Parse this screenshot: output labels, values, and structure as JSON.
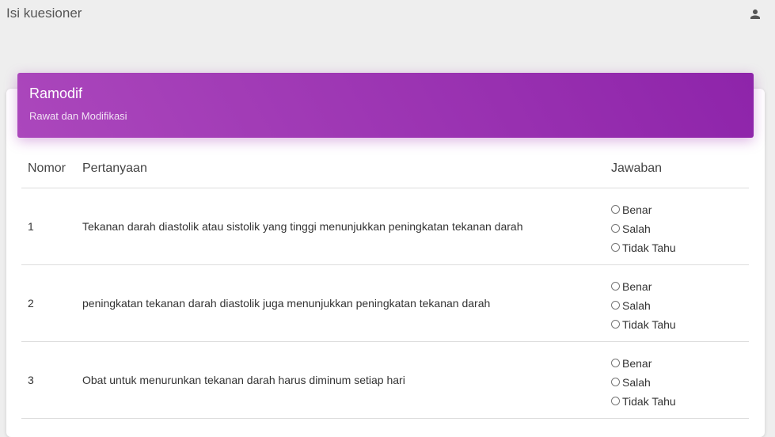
{
  "header": {
    "title": "Isi kuesioner",
    "user_icon": "person-icon"
  },
  "card": {
    "title": "Ramodif",
    "subtitle": "Rawat dan Modifikasi"
  },
  "table": {
    "columns": [
      "Nomor",
      "Pertanyaan",
      "Jawaban"
    ],
    "rows": [
      {
        "number": "1",
        "question": "Tekanan darah diastolik atau sistolik yang tinggi menunjukkan peningkatan tekanan darah"
      },
      {
        "number": "2",
        "question": "peningkatan tekanan darah diastolik juga menunjukkan peningkatan tekanan darah"
      },
      {
        "number": "3",
        "question": "Obat untuk menurunkan tekanan darah harus diminum setiap hari"
      }
    ],
    "options": [
      "Benar",
      "Salah",
      "Tidak Tahu"
    ]
  },
  "colors": {
    "accent_start": "#ab47bc",
    "accent_end": "#8e24aa",
    "background": "#eeeeee"
  }
}
